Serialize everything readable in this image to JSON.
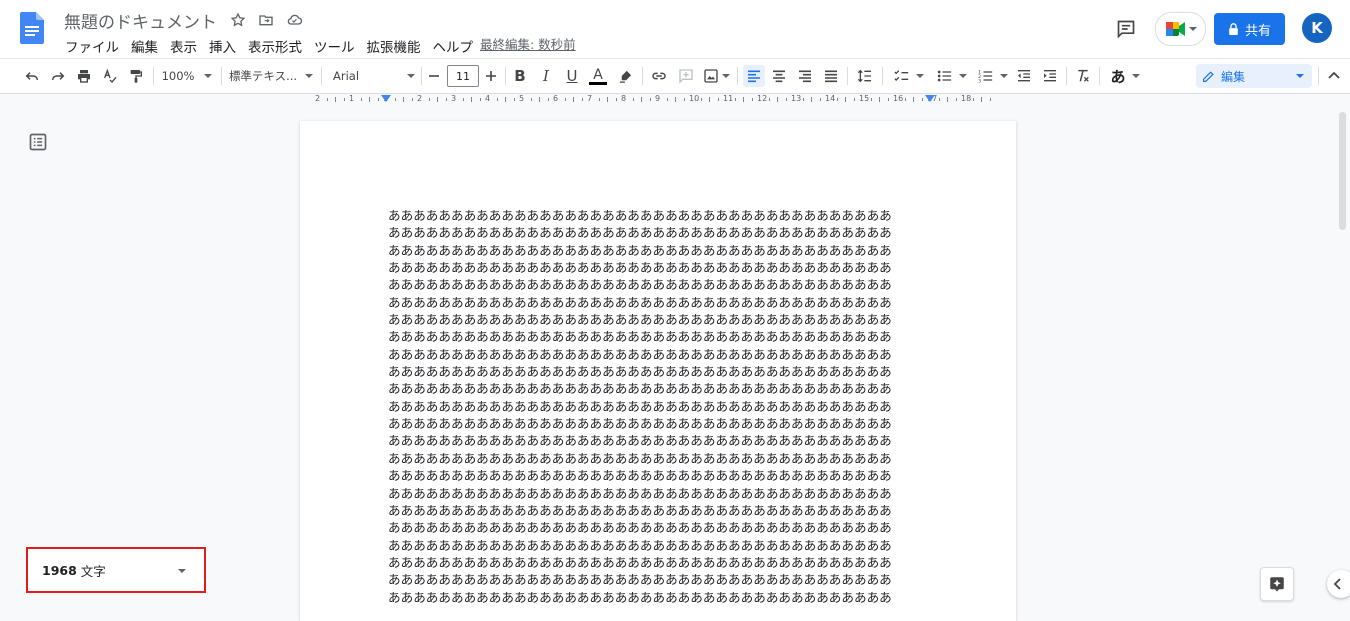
{
  "app": {
    "doc_title": "無題のドキュメント",
    "last_edit": "最終編集: 数秒前",
    "share_label": "共有",
    "avatar_letter": "K"
  },
  "menu": [
    "ファイル",
    "編集",
    "表示",
    "挿入",
    "表示形式",
    "ツール",
    "拡張機能",
    "ヘルプ"
  ],
  "toolbar": {
    "zoom": "100%",
    "style": "標準テキス...",
    "font": "Arial",
    "font_size": "11",
    "mode": "編集",
    "ime_label": "あ"
  },
  "ruler_labels": [
    "2",
    "1",
    "1",
    "2",
    "3",
    "4",
    "5",
    "6",
    "7",
    "8",
    "9",
    "10",
    "11",
    "12",
    "13",
    "14",
    "15",
    "16",
    "17",
    "18"
  ],
  "document": {
    "lines": [
      "ああああああああああああああああああああああああああああああああああああああああ",
      "ああああああああああああああああああああああああああああああああああああああああ",
      "ああああああああああああああああああああああああああああああああああああああああ",
      "ああああああああああああああああああああああああああああああああああああああああ",
      "ああああああああああああああああああああああああああああああああああああああああ",
      "ああああああああああああああああああああああああああああああああああああああああ",
      "ああああああああああああああああああああああああああああああああああああああああ",
      "ああああああああああああああああああああああああああああああああああああああああ",
      "ああああああああああああああああああああああああああああああああああああああああ",
      "ああああああああああああああああああああああああああああああああああああああああ",
      "ああああああああああああああああああああああああああああああああああああああああ",
      "ああああああああああああああああああああああああああああああああああああああああ",
      "ああああああああああああああああああああああああああああああああああああああああ",
      "ああああああああああああああああああああああああああああああああああああああああ",
      "ああああああああああああああああああああああああああああああああああああああああ",
      "ああああああああああああああああああああああああああああああああああああああああ",
      "ああああああああああああああああああああああああああああああああああああああああ",
      "ああああああああああああああああああああああああああああああああああああああああ",
      "ああああああああああああああああああああああああああああああああああああああああ",
      "ああああああああああああああああああああああああああああああああああああああああ",
      "ああああああああああああああああああああああああああああああああああああああああ",
      "ああああああああああああああああああああああああああああああああああああああああ",
      "ああああああああああああああああああああああああああああああああああああああああ"
    ]
  },
  "word_count": {
    "number": "1968",
    "unit": "文字"
  },
  "colors": {
    "accent": "#1a73e8",
    "highlight_border": "#e21b1b",
    "avatar": "#1565c0"
  }
}
